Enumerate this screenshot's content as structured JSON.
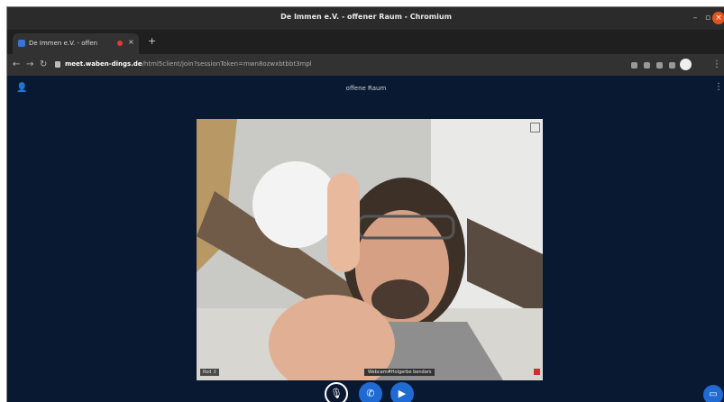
{
  "window": {
    "title": "De Immen e.V. - offener Raum - Chromium"
  },
  "tab": {
    "label": "De Immen e.V. - offen"
  },
  "toolbar": {
    "url_host": "meet.waben-dings.de",
    "url_path": "/html5client/join?sessionToken=mwn8ozwxbtbbt3mpl"
  },
  "room": {
    "name": "offene Raum"
  },
  "video": {
    "left_tag": "Rod ↕",
    "name_tag": "Webcam#Holgerbe bendars"
  },
  "colors": {
    "accent": "#1f6bd3",
    "background": "#0a1932"
  }
}
